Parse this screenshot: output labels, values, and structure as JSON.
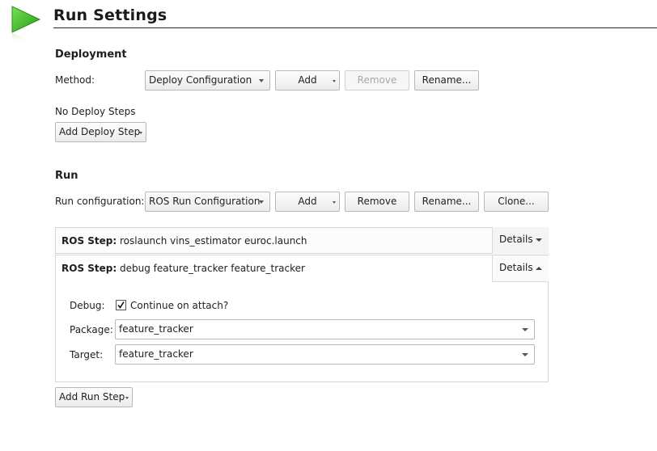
{
  "header": {
    "title": "Run Settings",
    "icon": "run-play-icon",
    "accent": "#3dbb1f"
  },
  "deployment": {
    "section_label": "Deployment",
    "method_label": "Method:",
    "method_value": "Deploy Configuration",
    "add_label": "Add",
    "remove_label": "Remove",
    "rename_label": "Rename...",
    "no_steps_text": "No Deploy Steps",
    "add_step_label": "Add Deploy Step"
  },
  "run": {
    "section_label": "Run",
    "config_label": "Run configuration:",
    "config_value": "ROS Run Configuration",
    "add_label": "Add",
    "remove_label": "Remove",
    "rename_label": "Rename...",
    "clone_label": "Clone...",
    "steps": [
      {
        "prefix": "ROS Step:",
        "text": "roslaunch vins_estimator euroc.launch",
        "details_label": "Details",
        "expanded": false
      },
      {
        "prefix": "ROS Step:",
        "text": "debug feature_tracker feature_tracker",
        "details_label": "Details",
        "expanded": true
      }
    ],
    "debug_label": "Debug:",
    "continue_label": "Continue on attach?",
    "continue_checked": true,
    "package_label": "Package:",
    "package_value": "feature_tracker",
    "target_label": "Target:",
    "target_value": "feature_tracker",
    "add_step_label": "Add Run Step"
  }
}
